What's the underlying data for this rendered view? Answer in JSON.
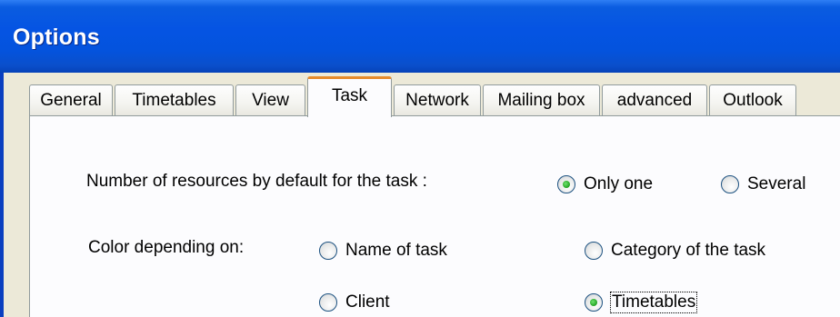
{
  "window": {
    "title": "Options"
  },
  "tabs": [
    {
      "label": "General"
    },
    {
      "label": "Timetables"
    },
    {
      "label": "View"
    },
    {
      "label": "Task",
      "active": true
    },
    {
      "label": "Network"
    },
    {
      "label": "Mailing box"
    },
    {
      "label": "advanced"
    },
    {
      "label": "Outlook"
    }
  ],
  "task_page": {
    "resources": {
      "label": "Number of resources by default for the task :",
      "options": [
        {
          "label": "Only one",
          "checked": true
        },
        {
          "label": "Several",
          "checked": false
        }
      ]
    },
    "color": {
      "label": "Color depending on:",
      "options": [
        {
          "label": "Name of task",
          "checked": false
        },
        {
          "label": "Category of the task",
          "checked": false
        },
        {
          "label": "Client",
          "checked": false
        },
        {
          "label": "Timetables",
          "checked": true,
          "focused": true
        }
      ]
    }
  },
  "colors": {
    "titlebar": "#0554e3",
    "active_tab_accent": "#e68b2c",
    "radio_checked_dot": "#21a121"
  }
}
